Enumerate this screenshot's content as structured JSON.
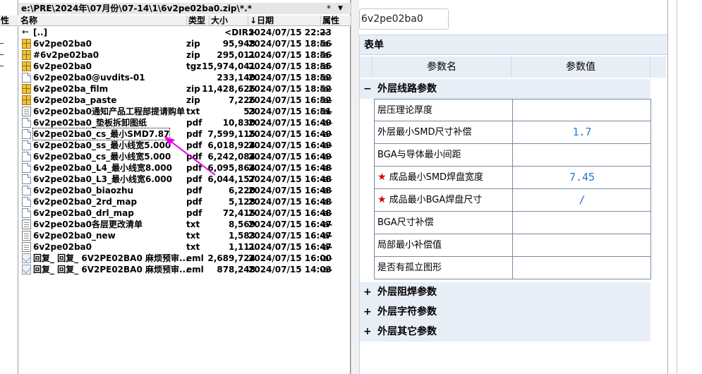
{
  "left_strip": {
    "header": "性"
  },
  "file_panel": {
    "path": "e:\\PRE\\2024年\\07月份\\07-14\\1\\6v2pe02ba0.zip\\*.*",
    "path_star": "*",
    "path_arrow": "▼",
    "columns": {
      "name": "名称",
      "type": "类型",
      "size": "大小",
      "date": "↓日期",
      "attr": "属性"
    },
    "files": [
      {
        "icon": "up-icon",
        "name": "[..]",
        "type": "",
        "size": "<DIR>",
        "date": "2024/07/15 22:23",
        "attr": "—"
      },
      {
        "icon": "zip-icon",
        "name": "6v2pe02ba0",
        "type": "zip",
        "size": "95,948",
        "date": "2024/07/15 18:56",
        "attr": "-a-"
      },
      {
        "icon": "zip-icon",
        "name": "#6v2pe02ba0",
        "type": "zip",
        "size": "295,011",
        "date": "2024/07/15 18:56",
        "attr": "-a-"
      },
      {
        "icon": "zip-icon",
        "name": "6v2pe02ba0",
        "type": "tgz",
        "size": "15,974,041",
        "date": "2024/07/15 18:55",
        "attr": "-a-"
      },
      {
        "icon": "doc-icon",
        "name": "6v2pe02ba0@uvdits-01",
        "type": "",
        "size": "233,140",
        "date": "2024/07/15 18:52",
        "attr": "-a-"
      },
      {
        "icon": "zip-icon",
        "name": "6v2pe02ba_film",
        "type": "zip",
        "size": "11,428,626",
        "date": "2024/07/15 18:52",
        "attr": "-a-"
      },
      {
        "icon": "zip-icon",
        "name": "6v2pe02ba_paste",
        "type": "zip",
        "size": "7,226",
        "date": "2024/07/15 16:52",
        "attr": "-a-"
      },
      {
        "icon": "txt-icon",
        "name": "6v2pe02ba0通知产品工程部提请购单",
        "type": "txt",
        "size": "53",
        "date": "2024/07/15 16:51",
        "attr": "-a-"
      },
      {
        "icon": "doc-icon",
        "name": "6v2pe02ba0_垫板拆卸图纸",
        "type": "pdf",
        "size": "10,830",
        "date": "2024/07/15 16:49",
        "attr": "-a-"
      },
      {
        "icon": "doc-icon",
        "name": "6v2pe02ba0_cs_最小SMD7.87",
        "type": "pdf",
        "size": "7,599,115",
        "date": "2024/07/15 16:49",
        "attr": "-a-",
        "selected": true
      },
      {
        "icon": "doc-icon",
        "name": "6v2pe02ba0_ss_最小线宽5.000",
        "type": "pdf",
        "size": "6,018,924",
        "date": "2024/07/15 16:49",
        "attr": "-a-"
      },
      {
        "icon": "doc-icon",
        "name": "6v2pe02ba0_cs_最小线宽5.000",
        "type": "pdf",
        "size": "6,242,084",
        "date": "2024/07/15 16:49",
        "attr": "-a-"
      },
      {
        "icon": "doc-icon",
        "name": "6v2pe02ba0_L4_最小线宽8.000",
        "type": "pdf",
        "size": "6,095,864",
        "date": "2024/07/15 16:48",
        "attr": "-a-"
      },
      {
        "icon": "doc-icon",
        "name": "6v2pe02ba0_L3_最小线宽6.000",
        "type": "pdf",
        "size": "6,044,157",
        "date": "2024/07/15 16:48",
        "attr": "-a-"
      },
      {
        "icon": "doc-icon",
        "name": "6v2pe02ba0_biaozhu",
        "type": "pdf",
        "size": "6,220",
        "date": "2024/07/15 16:48",
        "attr": "-a-"
      },
      {
        "icon": "doc-icon",
        "name": "6v2pe02ba0_2rd_map",
        "type": "pdf",
        "size": "5,128",
        "date": "2024/07/15 16:48",
        "attr": "-a-"
      },
      {
        "icon": "doc-icon",
        "name": "6v2pe02ba0_drl_map",
        "type": "pdf",
        "size": "72,415",
        "date": "2024/07/15 16:48",
        "attr": "-a-"
      },
      {
        "icon": "txt-icon",
        "name": "6v2pe02ba0各层更改清单",
        "type": "txt",
        "size": "8,569",
        "date": "2024/07/15 16:47",
        "attr": "-a-"
      },
      {
        "icon": "txt-icon",
        "name": "6v2pe02ba0_new",
        "type": "txt",
        "size": "1,583",
        "date": "2024/07/15 16:47",
        "attr": "-a-"
      },
      {
        "icon": "txt-icon",
        "name": "6v2pe02ba0",
        "type": "txt",
        "size": "1,111",
        "date": "2024/07/15 16:47",
        "attr": "-a-"
      },
      {
        "icon": "eml-icon",
        "name": "回复_ 回复_ 6V2PE02BA0 麻烦预审...",
        "type": "eml",
        "size": "2,689,724",
        "date": "2024/07/15 16:00",
        "attr": "-a-"
      },
      {
        "icon": "eml-icon",
        "name": "回复_ 回复_ 6V2PE02BA0 麻烦预审...",
        "type": "eml",
        "size": "878,248",
        "date": "2024/07/15 14:03",
        "attr": "-a-"
      }
    ]
  },
  "form": {
    "name_input_value": "6v2pe02ba0",
    "table_title": "表单",
    "header": {
      "name": "参数名",
      "value": "参数值"
    },
    "groups": [
      {
        "label": "外层线路参数",
        "expanded": true,
        "toggle": "−",
        "params": [
          {
            "name": "层压理论厚度",
            "value": "",
            "required": false
          },
          {
            "name": "外层最小SMD尺寸补偿",
            "value": "1.7",
            "required": false
          },
          {
            "name": "BGA与导体最小间距",
            "value": "",
            "required": false
          },
          {
            "name": "成品最小SMD焊盘宽度",
            "value": "7.45",
            "required": true
          },
          {
            "name": "成品最小BGA焊盘尺寸",
            "value": "/",
            "required": true
          },
          {
            "name": "BGA尺寸补偿",
            "value": "",
            "required": false
          },
          {
            "name": "局部最小补偿值",
            "value": "",
            "required": false
          },
          {
            "name": "是否有孤立图形",
            "value": "",
            "required": false
          }
        ]
      },
      {
        "label": "外层阻焊参数",
        "expanded": false,
        "toggle": "+"
      },
      {
        "label": "外层字符参数",
        "expanded": false,
        "toggle": "+"
      },
      {
        "label": "外层其它参数",
        "expanded": false,
        "toggle": "+"
      }
    ]
  },
  "colors": {
    "annotation_arrow": "#e800e8",
    "value_text": "#2b7acb",
    "required_star": "#d40000",
    "group_bg": "#e8eef6"
  }
}
